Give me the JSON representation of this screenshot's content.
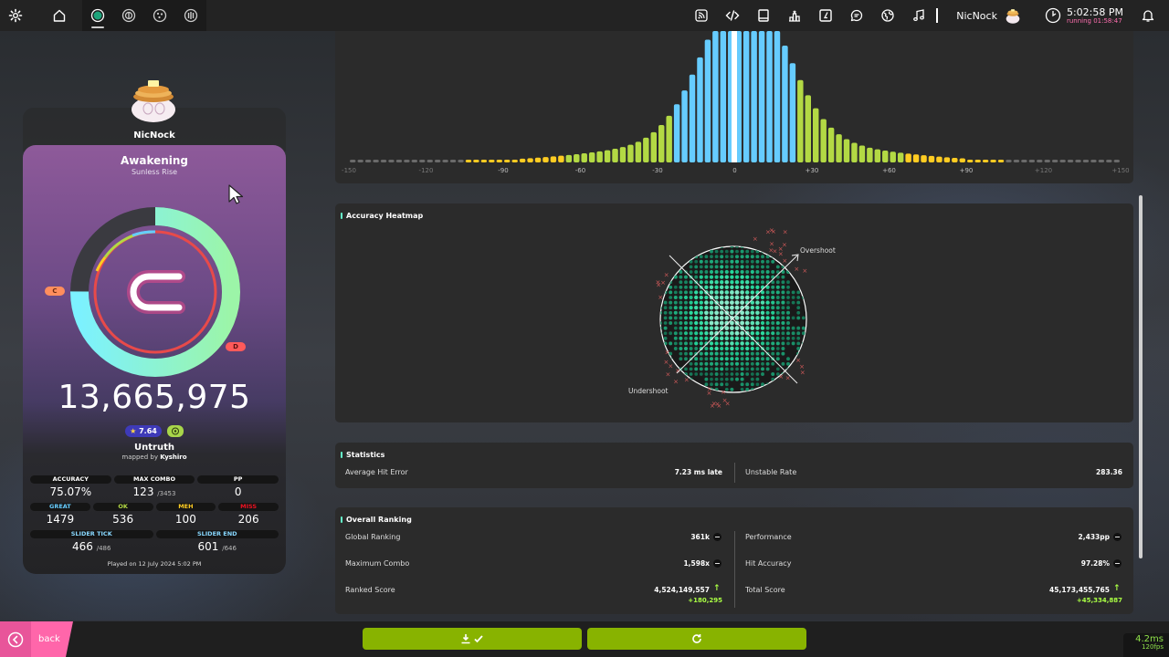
{
  "toolbar": {
    "username": "NicNock",
    "time": "5:02:58 PM",
    "running": "running 01:58:47"
  },
  "user": {
    "name": "NicNock"
  },
  "score": {
    "title": "Awakening",
    "artist": "Sunless Rise",
    "rank": "C",
    "rank_markers": [
      "C",
      "D"
    ],
    "total": "13,665,975",
    "star_rating": "7.64",
    "difficulty": "Untruth",
    "mapped_by_prefix": "mapped by",
    "mapper": "Kyshiro",
    "accuracy_fraction": 0.7507,
    "stats_row1": [
      {
        "label": "ACCURACY",
        "value": "75.07%",
        "suffix": ""
      },
      {
        "label": "MAX COMBO",
        "value": "123",
        "suffix": "/3453"
      },
      {
        "label": "PP",
        "value": "0",
        "suffix": ""
      }
    ],
    "stats_row2": [
      {
        "label": "GREAT",
        "value": "1479"
      },
      {
        "label": "OK",
        "value": "536"
      },
      {
        "label": "MEH",
        "value": "100"
      },
      {
        "label": "MISS",
        "value": "206"
      }
    ],
    "stats_row3": [
      {
        "label": "SLIDER TICK",
        "value": "466",
        "suffix": "/486"
      },
      {
        "label": "SLIDER END",
        "value": "601",
        "suffix": "/646"
      }
    ],
    "played_on": "Played on 12 July 2024 5:02 PM"
  },
  "histogram": {
    "tick_labels": [
      "-150",
      "-120",
      "-90",
      "-60",
      "-30",
      "0",
      "+30",
      "+60",
      "+90",
      "+120",
      "+150"
    ]
  },
  "heatmap": {
    "title": "Accuracy Heatmap",
    "overshoot": "Overshoot",
    "undershoot": "Undershoot"
  },
  "statistics": {
    "title": "Statistics",
    "avg_hit_error_label": "Average Hit Error",
    "avg_hit_error_value": "7.23 ms late",
    "unstable_rate_label": "Unstable Rate",
    "unstable_rate_value": "283.36"
  },
  "ranking": {
    "title": "Overall Ranking",
    "global_ranking_label": "Global Ranking",
    "global_ranking_value": "361k",
    "performance_label": "Performance",
    "performance_value": "2,433pp",
    "max_combo_label": "Maximum Combo",
    "max_combo_value": "1,598x",
    "hit_accuracy_label": "Hit Accuracy",
    "hit_accuracy_value": "97.28%",
    "ranked_score_label": "Ranked Score",
    "ranked_score_value": "4,524,149,557",
    "ranked_score_delta": "+180,295",
    "total_score_label": "Total Score",
    "total_score_value": "45,173,455,765",
    "total_score_delta": "+45,334,887"
  },
  "footer": {
    "back_label": "back",
    "fps_ms": "4.2ms",
    "fps": "120fps"
  },
  "colors": {
    "great": "#66ccff",
    "ok": "#b3d944",
    "meh": "#ffcc22",
    "miss": "#ed1121",
    "accent_pink": "#ff66aa",
    "action_green": "#88b300"
  }
}
